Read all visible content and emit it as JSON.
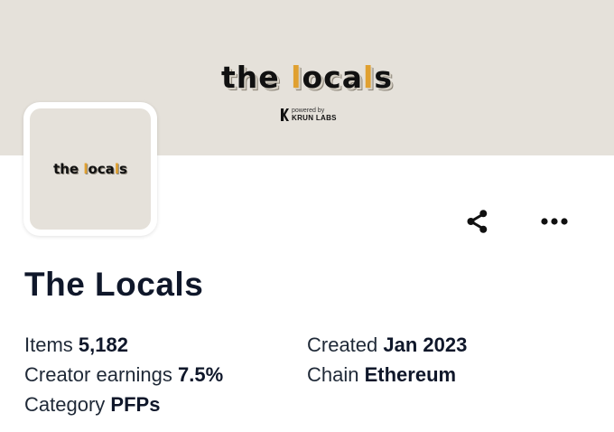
{
  "banner": {
    "logo_part1": "the ",
    "logo_highlight1": "l",
    "logo_part2": "oca",
    "logo_highlight2": "l",
    "logo_part3": "s",
    "powered_by": "powered by",
    "powered_brand": "KRUN LABS"
  },
  "avatar": {
    "logo_part1": "the ",
    "logo_highlight1": "l",
    "logo_part2": "oca",
    "logo_highlight2": "l",
    "logo_part3": "s"
  },
  "actions": {
    "share_icon": "share-icon",
    "more_icon": "more-icon"
  },
  "collection": {
    "name": "The Locals",
    "stats": [
      {
        "label": "Items",
        "value": "5,182"
      },
      {
        "label": "Created",
        "value": "Jan 2023"
      },
      {
        "label": "Creator earnings",
        "value": "7.5%"
      },
      {
        "label": "Chain",
        "value": "Ethereum"
      },
      {
        "label": "Category",
        "value": "PFPs"
      }
    ]
  },
  "colors": {
    "banner_bg": "#e5e1da",
    "logo_accent": "#e0a030",
    "text_dark": "#0f172a"
  }
}
